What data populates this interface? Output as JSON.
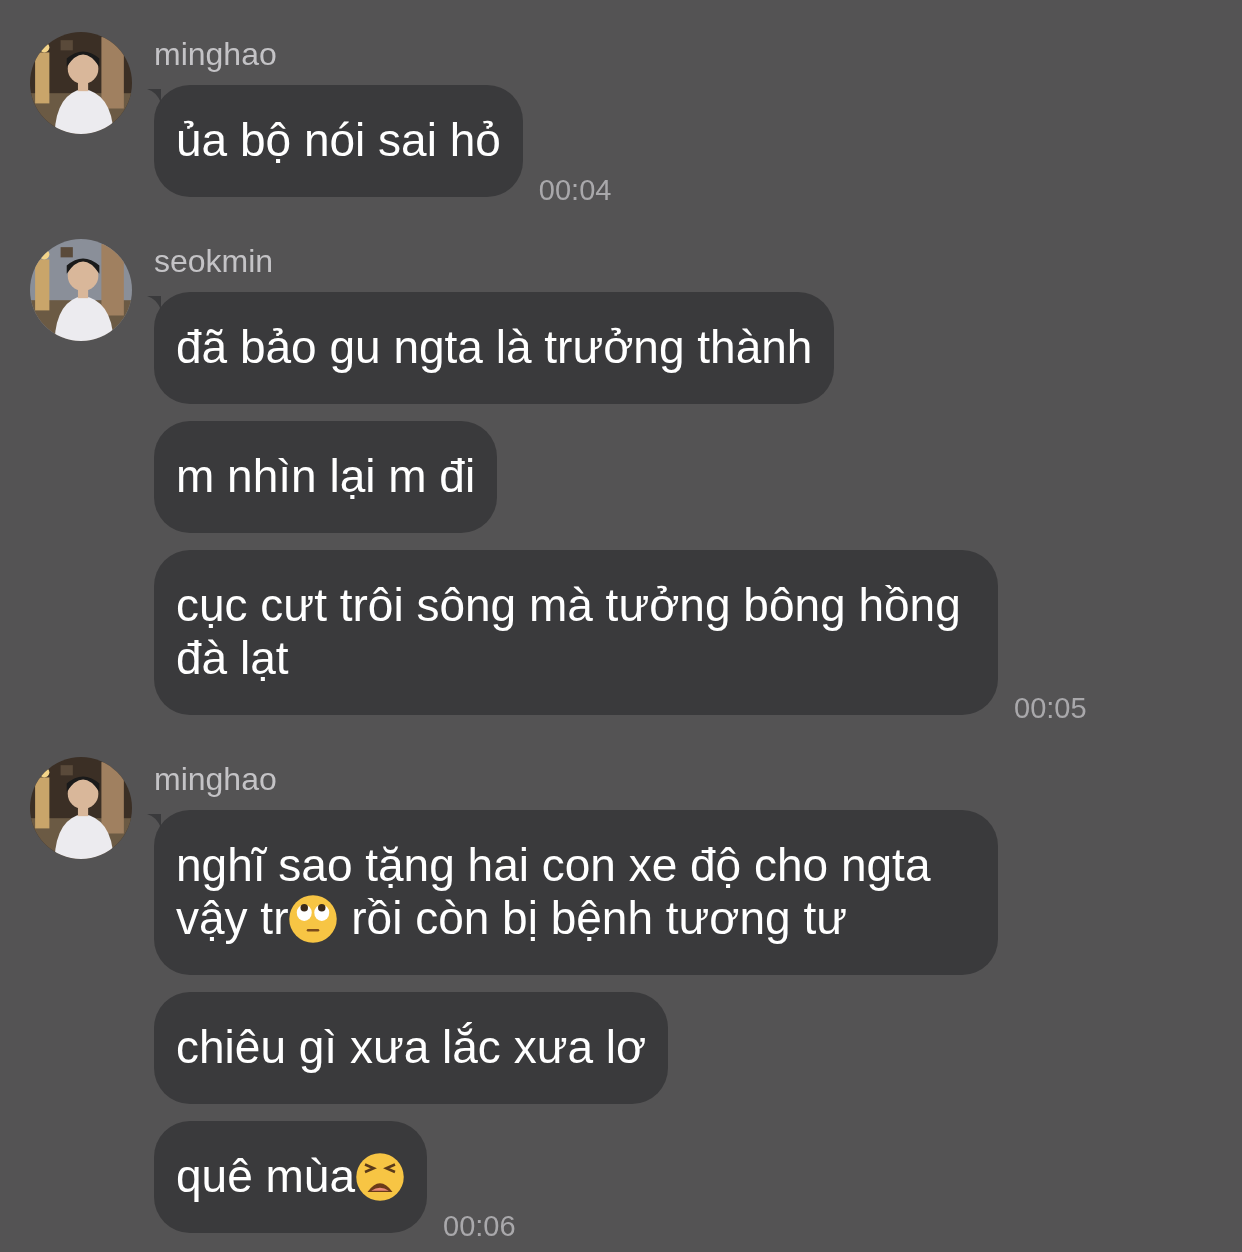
{
  "groups": [
    {
      "sender": "minghao",
      "avatar": {
        "kind": "picture"
      },
      "messages": [
        {
          "parts": [
            {
              "kind": "text",
              "text": "ủa bộ nói sai hỏ"
            }
          ]
        }
      ],
      "time": "00:04"
    },
    {
      "sender": "seokmin",
      "avatar": {
        "kind": "picture"
      },
      "messages": [
        {
          "parts": [
            {
              "kind": "text",
              "text": "đã bảo gu ngta là trưởng thành"
            }
          ]
        },
        {
          "parts": [
            {
              "kind": "text",
              "text": "m nhìn lại m đi"
            }
          ]
        },
        {
          "parts": [
            {
              "kind": "text",
              "text": "cục cưt trôi sông mà tưởng bông hồng đà lạt"
            }
          ]
        }
      ],
      "time": "00:05"
    },
    {
      "sender": "minghao",
      "avatar": {
        "kind": "picture"
      },
      "messages": [
        {
          "parts": [
            {
              "kind": "text",
              "text": "nghĩ sao tặng hai con xe độ cho ngta vậy tr"
            },
            {
              "kind": "eye_roll_emoji"
            },
            {
              "kind": "text",
              "text": " rồi còn bị bệnh tương tư"
            }
          ]
        },
        {
          "parts": [
            {
              "kind": "text",
              "text": "chiêu gì xưa lắc xưa lơ"
            }
          ]
        },
        {
          "parts": [
            {
              "kind": "text",
              "text": "quê mùa"
            },
            {
              "kind": "weary_emoji"
            }
          ]
        }
      ],
      "time": "00:06"
    }
  ]
}
